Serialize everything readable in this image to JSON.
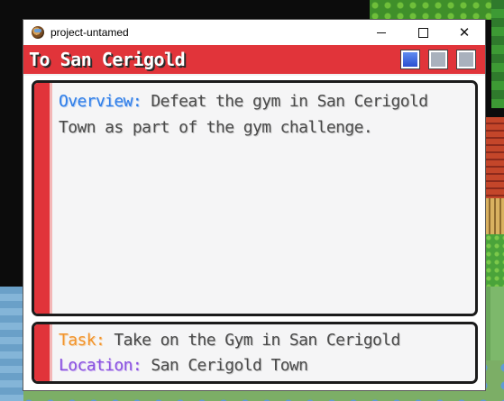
{
  "window": {
    "title": "project-untamed",
    "controls": {
      "minimize": "minimize",
      "maximize": "maximize",
      "close": "close"
    }
  },
  "quest": {
    "title": "To San Cerigold",
    "header_buttons": [
      {
        "name": "page-1",
        "state": "active"
      },
      {
        "name": "page-2",
        "state": "inactive"
      },
      {
        "name": "page-3",
        "state": "inactive"
      }
    ],
    "overview": {
      "label": "Overview:",
      "text": " Defeat the gym in San Cerigold Town as part of the gym challenge."
    },
    "task": {
      "label": "Task:",
      "text": " Take on the Gym in San Cerigold"
    },
    "location": {
      "label": "Location:",
      "text": " San Cerigold Town"
    }
  },
  "colors": {
    "accent_red": "#e1343a",
    "label_blue": "#2f7ee8",
    "label_orange": "#f2942c",
    "label_purple": "#8a52e0",
    "body_text": "#4a4a4a"
  },
  "icons": {
    "app": "pokeball-icon",
    "close": "close-icon",
    "minimize": "minimize-icon",
    "maximize": "maximize-icon"
  }
}
